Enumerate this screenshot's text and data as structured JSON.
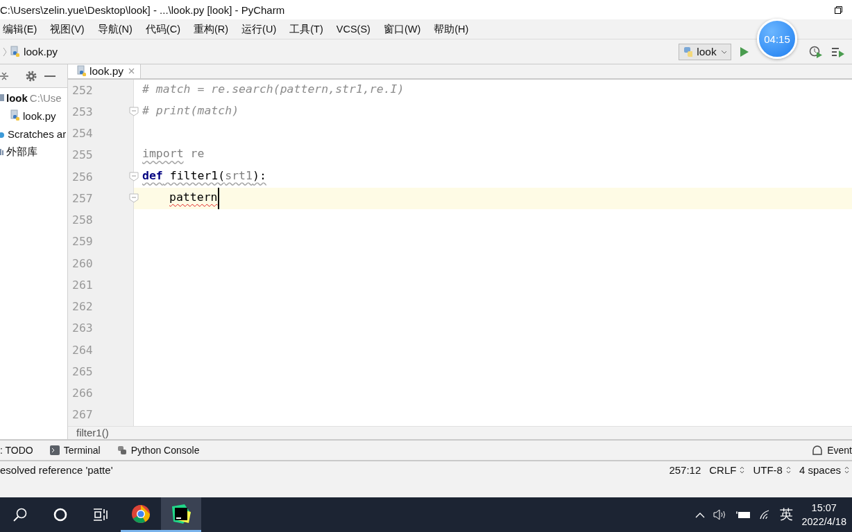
{
  "window": {
    "title": "C:\\Users\\zelin.yue\\Desktop\\look] - ...\\look.py [look] - PyCharm"
  },
  "menu": [
    "编辑(E)",
    "视图(V)",
    "导航(N)",
    "代码(C)",
    "重构(R)",
    "运行(U)",
    "工具(T)",
    "VCS(S)",
    "窗口(W)",
    "帮助(H)"
  ],
  "navbar": {
    "breadcrumb": "look.py",
    "run_config": "look"
  },
  "timer": "04:15",
  "project": {
    "items": [
      {
        "label": "look",
        "path": "C:\\Use",
        "kind": "root",
        "children": [
          {
            "label": "look.py",
            "kind": "file"
          }
        ]
      },
      {
        "label": "Scratches ar",
        "kind": "scratches"
      },
      {
        "label": "外部库",
        "kind": "library"
      }
    ]
  },
  "editor": {
    "tabs": [
      {
        "label": "look.py",
        "selected": true
      }
    ],
    "lines": [
      {
        "number": "252",
        "segments": [
          {
            "text": "# match = re.search(pattern,str1,re.I)",
            "kind": "comment"
          }
        ]
      },
      {
        "number": "253",
        "fold": true,
        "segments": [
          {
            "text": "# print(match)",
            "kind": "comment"
          }
        ]
      },
      {
        "number": "254"
      },
      {
        "number": "255",
        "segments": [
          {
            "text": "import",
            "kind": "unused",
            "warning": true
          },
          {
            "text": " re",
            "kind": "unused"
          }
        ]
      },
      {
        "number": "256",
        "fold": true,
        "segments": [
          {
            "text": "def",
            "kind": "keyword",
            "warning": true
          },
          {
            "text": " filter1(",
            "kind": "plain",
            "warning": true
          },
          {
            "text": "srt1",
            "kind": "param",
            "warning": true
          },
          {
            "text": "):",
            "kind": "plain",
            "warning": true
          }
        ]
      },
      {
        "number": "257",
        "fold": true,
        "current": true,
        "indented": true,
        "segments": [
          {
            "text": "pattern",
            "kind": "plain",
            "error": true
          }
        ]
      },
      {
        "number": "258"
      },
      {
        "number": "259"
      },
      {
        "number": "260"
      },
      {
        "number": "261"
      },
      {
        "number": "262"
      },
      {
        "number": "263"
      },
      {
        "number": "264"
      },
      {
        "number": "265"
      },
      {
        "number": "266"
      },
      {
        "number": "267"
      }
    ],
    "breadcrumb": "filter1()"
  },
  "tool_windows": [
    {
      "label": ": TODO",
      "kind": "todo"
    },
    {
      "label": "Terminal",
      "kind": "terminal"
    },
    {
      "label": "Python Console",
      "kind": "python"
    },
    {
      "label": "Event",
      "kind": "event"
    }
  ],
  "status_bar": {
    "message": "esolved reference 'patte'",
    "position": "257:12",
    "items": [
      "CRLF",
      "UTF-8",
      "4 spaces"
    ]
  },
  "taskbar": {
    "apps": [
      {
        "kind": "search",
        "selected": false
      },
      {
        "kind": "cortana",
        "selected": false
      },
      {
        "kind": "taskview",
        "selected": false
      },
      {
        "kind": "chrome",
        "selected": false
      },
      {
        "kind": "pycharm",
        "selected": true
      }
    ],
    "ime": "英",
    "time": "15:07",
    "date": "2022/4/18"
  }
}
